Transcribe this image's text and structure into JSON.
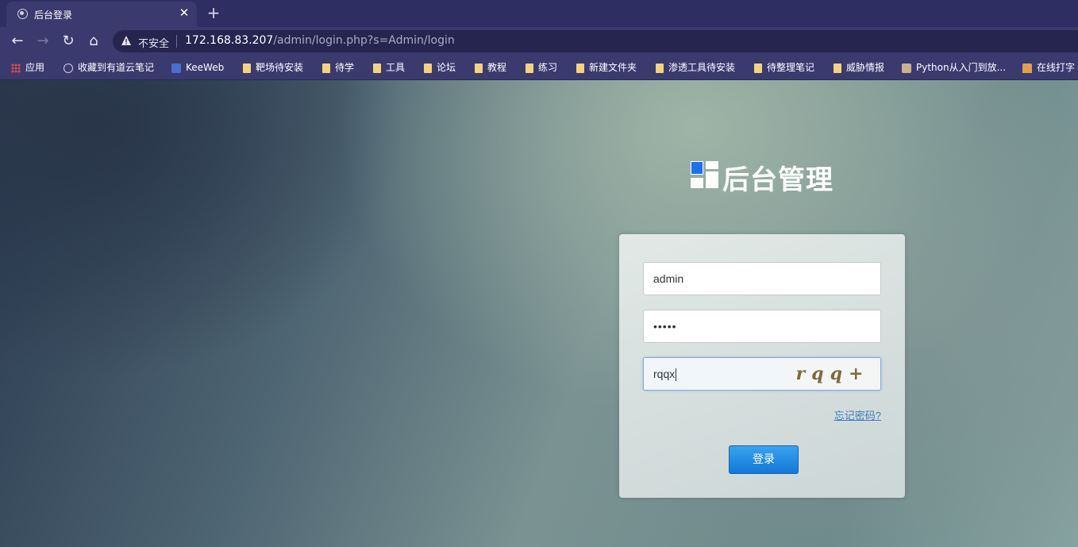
{
  "browser": {
    "tab_title": "后台登录",
    "close_glyph": "✕",
    "new_tab_glyph": "+",
    "back_glyph": "←",
    "forward_glyph": "→",
    "reload_glyph": "↻",
    "home_glyph": "⌂",
    "security_label": "不安全",
    "url_host": "172.168.83.207",
    "url_path": "/admin/login.php?s=Admin/login"
  },
  "bookmarks": [
    {
      "label": "应用",
      "icon": "apps-icon"
    },
    {
      "label": "收藏到有道云笔记",
      "icon": "globe-icon"
    },
    {
      "label": "KeeWeb",
      "icon": "keeweb-icon"
    },
    {
      "label": "靶场待安装",
      "icon": "folder-icon"
    },
    {
      "label": "待学",
      "icon": "folder-icon"
    },
    {
      "label": "工具",
      "icon": "folder-icon"
    },
    {
      "label": "论坛",
      "icon": "folder-icon"
    },
    {
      "label": "教程",
      "icon": "folder-icon"
    },
    {
      "label": "练习",
      "icon": "folder-icon"
    },
    {
      "label": "新建文件夹",
      "icon": "folder-icon"
    },
    {
      "label": "渗透工具待安装",
      "icon": "folder-icon"
    },
    {
      "label": "待整理笔记",
      "icon": "folder-icon"
    },
    {
      "label": "威胁情报",
      "icon": "folder-icon"
    },
    {
      "label": "Python从入门到放...",
      "icon": "python-icon"
    },
    {
      "label": "在线打字",
      "icon": "house-icon"
    }
  ],
  "page": {
    "logo_title": "后台管理",
    "username_value": "admin",
    "password_value": "•••••",
    "captcha_value": "rqqx",
    "captcha_image_text": "rqq+",
    "forgot_label": "忘记密码?",
    "login_label": "登录"
  },
  "colors": {
    "accent": "#1a84e2",
    "logo_blue": "#1e6ff0",
    "link": "#3f7bbf"
  }
}
